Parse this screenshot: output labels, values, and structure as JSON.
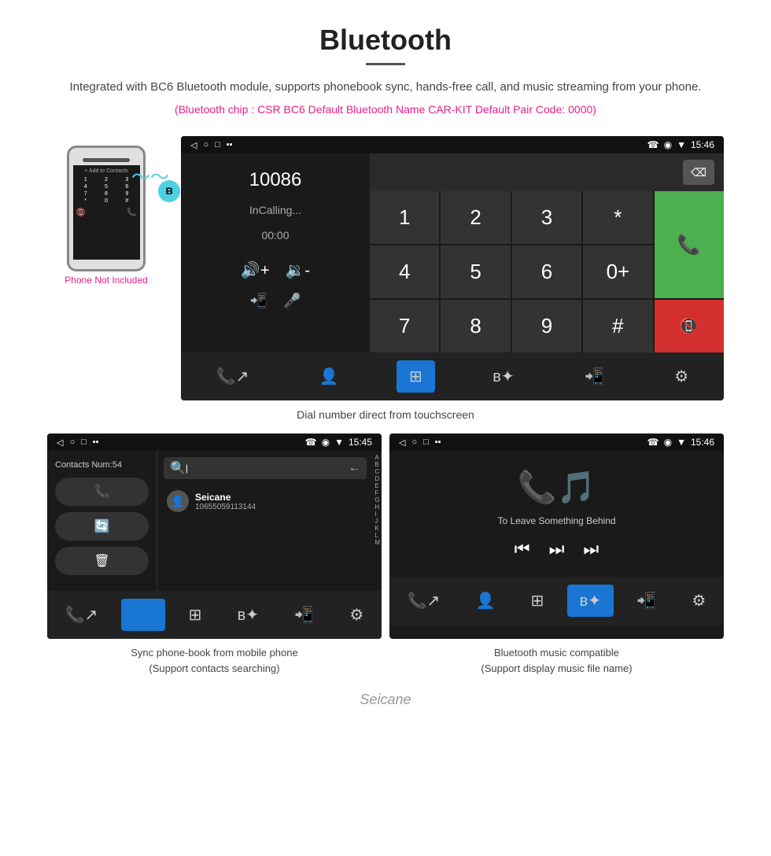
{
  "header": {
    "title": "Bluetooth",
    "description": "Integrated with BC6 Bluetooth module, supports phonebook sync, hands-free call, and music streaming from your phone.",
    "specs": "(Bluetooth chip : CSR BC6    Default Bluetooth Name CAR-KIT    Default Pair Code: 0000)"
  },
  "dial_screen": {
    "status_bar": {
      "time": "15:46",
      "icons_left": [
        "◁",
        "○",
        "□",
        "▪▪"
      ],
      "icons_right": [
        "☎",
        "◉",
        "▼",
        "15:46"
      ]
    },
    "number": "10086",
    "status": "InCalling...",
    "call_time": "00:00",
    "keys": [
      "1",
      "2",
      "3",
      "*",
      "4",
      "5",
      "6",
      "0+",
      "7",
      "8",
      "9",
      "#"
    ],
    "caption": "Dial number direct from touchscreen"
  },
  "contacts_screen": {
    "status_bar_time": "15:45",
    "contacts_num_label": "Contacts Num:54",
    "search_placeholder": "Search",
    "contact": {
      "name": "Seicane",
      "number": "10655059113144"
    },
    "alphabet": [
      "A",
      "B",
      "C",
      "D",
      "E",
      "F",
      "G",
      "H",
      "I",
      "J",
      "K",
      "L",
      "M"
    ],
    "caption_line1": "Sync phone-book from mobile phone",
    "caption_line2": "(Support contacts searching)"
  },
  "music_screen": {
    "status_bar_time": "15:46",
    "song_title": "To Leave Something Behind",
    "caption_line1": "Bluetooth music compatible",
    "caption_line2": "(Support display music file name)"
  },
  "phone_label": "Phone Not Included",
  "watermark": "Seicane"
}
